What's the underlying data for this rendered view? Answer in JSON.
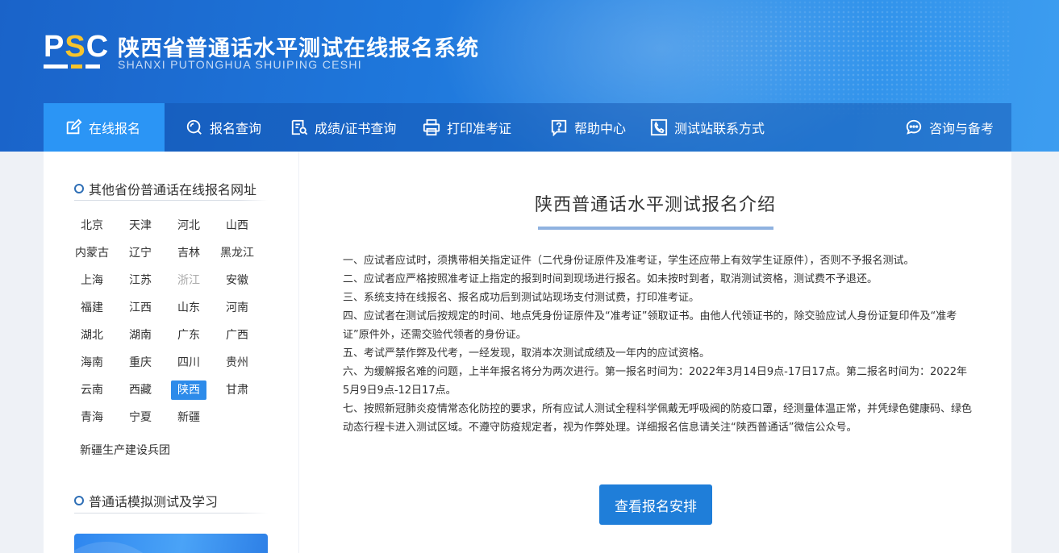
{
  "header": {
    "logo_text": "PSC",
    "title": "陕西省普通话水平测试在线报名系统",
    "subtitle": "SHANXI PUTONGHUA SHUIPING CESHI"
  },
  "nav": {
    "items": [
      {
        "label": "在线报名",
        "icon": "edit-icon"
      },
      {
        "label": "报名查询",
        "icon": "search-icon"
      },
      {
        "label": "成绩/证书查询",
        "icon": "certificate-search-icon"
      },
      {
        "label": "打印准考证",
        "icon": "printer-icon"
      },
      {
        "label": "帮助中心",
        "icon": "help-icon"
      },
      {
        "label": "测试站联系方式",
        "icon": "phone-icon"
      },
      {
        "label": "咨询与备考",
        "icon": "chat-icon"
      }
    ],
    "active_label": "在线报名"
  },
  "sidebar": {
    "section1_title": "其他省份普通话在线报名网址",
    "provinces": [
      "北京",
      "天津",
      "河北",
      "山西",
      "内蒙古",
      "辽宁",
      "吉林",
      "黑龙江",
      "上海",
      "江苏",
      "浙江",
      "安徽",
      "福建",
      "江西",
      "山东",
      "河南",
      "湖北",
      "湖南",
      "广东",
      "广西",
      "海南",
      "重庆",
      "四川",
      "贵州",
      "云南",
      "西藏",
      "陕西",
      "甘肃",
      "青海",
      "宁夏",
      "新疆"
    ],
    "extra_province": "新疆生产建设兵团",
    "active_province": "陕西",
    "dim_province": "浙江",
    "section2_title": "普通话模拟测试及学习"
  },
  "main": {
    "title": "陕西普通话水平测试报名介绍",
    "notices": [
      "一、应试者应试时，须携带相关指定证件（二代身份证原件及准考证，学生还应带上有效学生证原件），否则不予报名测试。",
      "二、应试者应严格按照准考证上指定的报到时间到现场进行报名。如未按时到者，取消测试资格，测试费不予退还。",
      "三、系统支持在线报名、报名成功后到测试站现场支付测试费，打印准考证。",
      "四、应试者在测试后按规定的时间、地点凭身份证原件及“准考证”领取证书。由他人代领证书的，除交验应试人身份证复印件及“准考证”原件外，还需交验代领者的身份证。",
      "五、考试严禁作弊及代考，一经发现，取消本次测试成绩及一年内的应试资格。",
      "六、为缓解报名难的问题，上半年报名将分为两次进行。第一报名时间为：2022年3月14日9点-17日17点。第二报名时间为：2022年5月9日9点-12日17点。",
      "七、按照新冠肺炎疫情常态化防控的要求，所有应试人测试全程科学佩戴无呼吸阀的防疫口罩，经测量体温正常，并凭绿色健康码、绿色动态行程卡进入测试区域。不遵守防疫规定者，视为作弊处理。详细报名信息请关注“陕西普通话”微信公众号。"
    ],
    "button_label": "查看报名安排"
  },
  "colors": {
    "header_blue": "#1f78dc",
    "nav_active": "#2b95f5",
    "button_blue": "#1f7ed9",
    "logo_accent": "#f7c42c"
  }
}
